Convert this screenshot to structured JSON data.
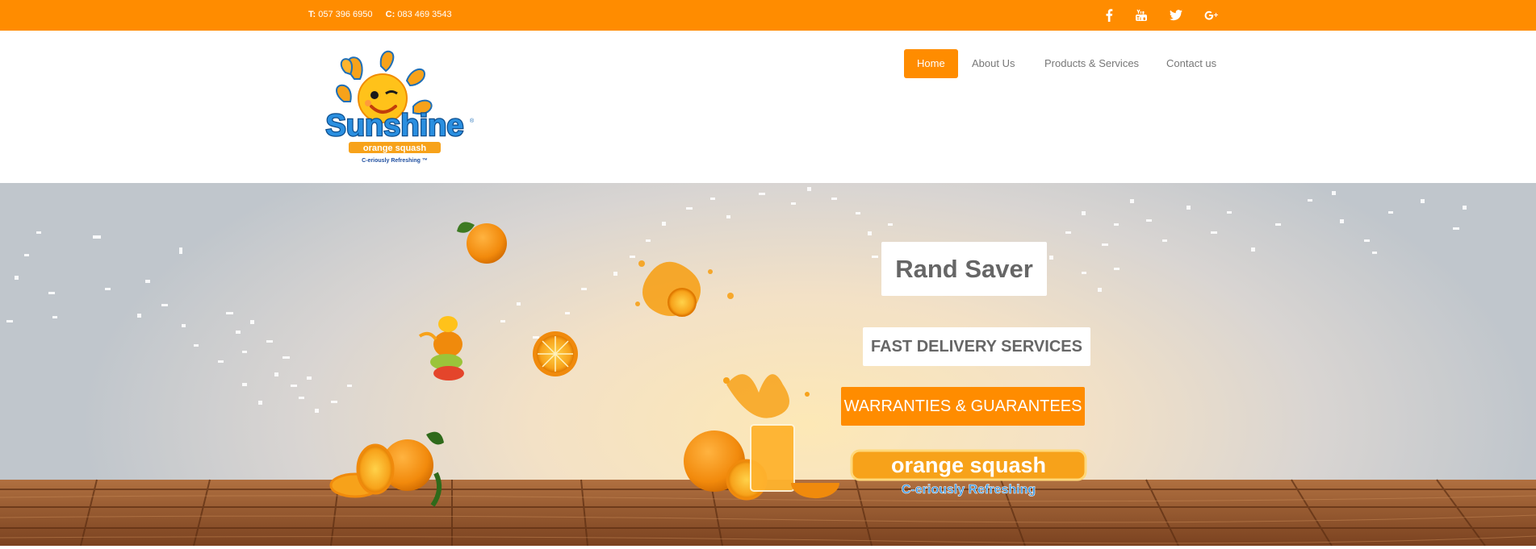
{
  "topbar": {
    "phone_label": "T:",
    "phone": "057 396 6950",
    "cell_label": "C:",
    "cell": "083 469 3543",
    "social": [
      "facebook-icon",
      "youtube-icon",
      "twitter-icon",
      "google-plus-icon"
    ]
  },
  "header": {
    "logo": {
      "brand": "Sunshine",
      "product": "orange squash",
      "tagline": "C-eriously Refreshing"
    },
    "nav": [
      {
        "label": "Home",
        "active": true
      },
      {
        "label": "About Us",
        "active": false
      },
      {
        "label": "Products & Services",
        "active": false
      },
      {
        "label": "Contact us",
        "active": false
      }
    ]
  },
  "hero": {
    "caption_1": "Rand Saver",
    "caption_2": "FAST DELIVERY SERVICES",
    "caption_3": "WARRANTIES & GUARANTEES",
    "badge_product": "orange squash",
    "badge_tagline": "C-eriously Refreshing"
  },
  "colors": {
    "accent": "#ff8c00",
    "nav_text": "#777777",
    "caption_text": "#666666",
    "wood": "#9a5a2c"
  }
}
